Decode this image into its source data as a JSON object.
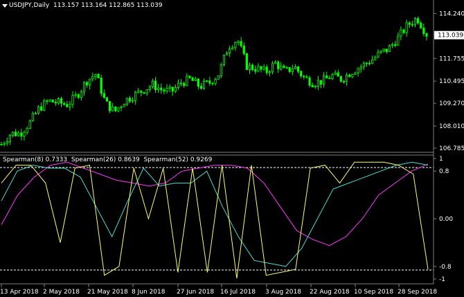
{
  "header": {
    "symbol": "USDJPY,Daily",
    "ohlc": "113.157 113.164 112.865 113.039"
  },
  "indicator": {
    "label_8": "Spearman(8)",
    "val_8": "0.7333",
    "label_26": "Spearman(26)",
    "val_26": "0.8639",
    "label_52": "Spearman(52)",
    "val_52": "0.9269"
  },
  "price_axis": {
    "ticks": [
      "114.240",
      "111.755",
      "110.495",
      "109.270",
      "108.010",
      "106.785"
    ],
    "current": "113.039"
  },
  "osc_axis": {
    "ticks": [
      "1",
      "0.8",
      "0.00",
      "-0.8",
      "-1"
    ]
  },
  "date_axis": {
    "labels": [
      "13 Apr 2018",
      "2 May 2018",
      "21 May 2018",
      "8 Jun 2018",
      "27 Jun 2018",
      "16 Jul 2018",
      "3 Aug 2018",
      "22 Aug 2018",
      "10 Sep 2018",
      "28 Sep 2018"
    ]
  },
  "colors": {
    "candles": "#00ff00",
    "s8": "#ffff66",
    "s26": "#40e0d0",
    "s52": "#ff33ff",
    "grid": "#808080",
    "level_lines": "#ffffff"
  },
  "chart_data": {
    "type": "line",
    "price_range": [
      106.785,
      114.6
    ],
    "osc_range": [
      -1,
      1
    ],
    "price_close_series": [
      107.0,
      107.6,
      107.6,
      108.2,
      109.0,
      109.4,
      109.3,
      109.2,
      109.7,
      110.5,
      110.9,
      109.3,
      108.8,
      109.4,
      109.7,
      110.0,
      110.3,
      110.0,
      109.9,
      110.4,
      110.6,
      110.2,
      110.4,
      110.9,
      112.4,
      112.8,
      111.3,
      111.2,
      111.0,
      111.5,
      111.0,
      111.3,
      110.7,
      110.4,
      110.5,
      110.8,
      110.6,
      111.0,
      111.3,
      111.6,
      112.0,
      112.3,
      112.9,
      113.6,
      114.0,
      113.1
    ],
    "spearman8_series": [
      0.6,
      0.9,
      0.9,
      0.6,
      -0.4,
      0.85,
      0.9,
      -0.95,
      -0.8,
      0.85,
      0.0,
      0.85,
      -0.9,
      0.85,
      -0.9,
      0.9,
      -1.0,
      0.9,
      -0.95,
      -0.9,
      -0.85,
      0.85,
      0.9,
      0.6,
      0.95,
      0.95,
      0.95,
      0.9,
      0.75,
      -0.85
    ],
    "spearman26_series": [
      0.3,
      0.8,
      0.9,
      0.85,
      0.85,
      0.7,
      0.2,
      -0.3,
      0.3,
      0.85,
      0.55,
      0.6,
      0.6,
      0.8,
      0.2,
      -0.3,
      -0.7,
      -0.75,
      -0.8,
      -0.5,
      0.0,
      0.5,
      0.6,
      0.7,
      0.8,
      0.9,
      0.95,
      0.9
    ],
    "spearman52_series": [
      -0.1,
      0.4,
      0.7,
      0.9,
      0.95,
      0.85,
      0.75,
      0.65,
      0.6,
      0.55,
      0.6,
      0.8,
      0.85,
      0.9,
      0.9,
      0.85,
      0.6,
      0.2,
      -0.2,
      -0.35,
      -0.45,
      -0.3,
      0.0,
      0.4,
      0.6,
      0.8,
      0.92
    ]
  }
}
